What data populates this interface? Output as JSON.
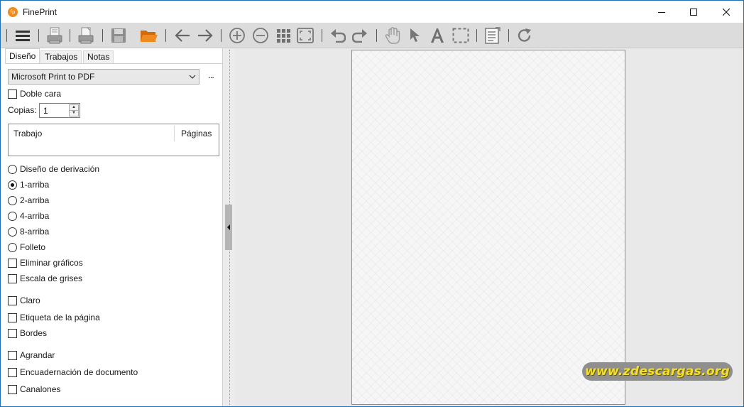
{
  "window": {
    "title": "FinePrint",
    "app_icon_text": "fp"
  },
  "toolbar": {
    "icons": [
      "menu-icon",
      "print-icon",
      "print-settings-icon",
      "save-icon",
      "open-folder-icon",
      "back-arrow-icon",
      "forward-arrow-icon",
      "zoom-in-icon",
      "zoom-out-icon",
      "thumbnails-icon",
      "fit-page-icon",
      "undo-icon",
      "redo-icon",
      "pan-hand-icon",
      "select-pointer-icon",
      "text-tool-icon",
      "marquee-select-icon",
      "letterhead-icon",
      "refresh-icon"
    ],
    "accent": "#f08a1c"
  },
  "tabs": [
    {
      "label": "Diseño",
      "active": true
    },
    {
      "label": "Trabajos",
      "active": false
    },
    {
      "label": "Notas",
      "active": false
    }
  ],
  "printer": {
    "selected": "Microsoft Print to PDF",
    "more": "..."
  },
  "duplex": {
    "label": "Doble cara",
    "checked": false
  },
  "copies": {
    "label": "Copias:",
    "value": "1"
  },
  "job_list": {
    "col_job": "Trabajo",
    "col_pages": "Páginas"
  },
  "layouts": [
    {
      "label": "Diseño de derivación",
      "selected": false
    },
    {
      "label": "1-arriba",
      "selected": true
    },
    {
      "label": "2-arriba",
      "selected": false
    },
    {
      "label": "4-arriba",
      "selected": false
    },
    {
      "label": "8-arriba",
      "selected": false
    },
    {
      "label": "Folleto",
      "selected": false
    }
  ],
  "options": [
    {
      "label": "Eliminar gráficos",
      "checked": false
    },
    {
      "label": "Escala de grises",
      "checked": false
    },
    {
      "label": "Claro",
      "checked": false
    },
    {
      "label": "Etiqueta de la página",
      "checked": false
    },
    {
      "label": "Bordes",
      "checked": false
    },
    {
      "label": "Agrandar",
      "checked": false
    },
    {
      "label": "Encuadernación de documento",
      "checked": false
    },
    {
      "label": "Canalones",
      "checked": false
    }
  ],
  "watermark": "www.zdescargas.org"
}
